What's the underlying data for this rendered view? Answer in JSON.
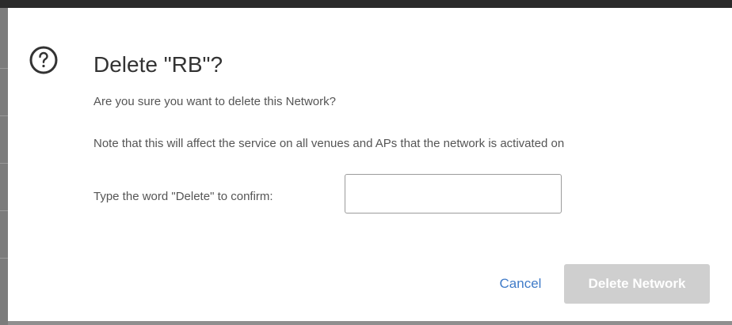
{
  "dialog": {
    "icon": "question-circle-icon",
    "title": "Delete \"RB\"?",
    "question": "Are you sure you want to delete this Network?",
    "note": "Note that this will affect the service on all venues and APs that the network is activated on",
    "confirm_label": "Type the word \"Delete\" to confirm:",
    "confirm_input_value": "",
    "cancel_label": "Cancel",
    "delete_label": "Delete Network"
  },
  "colors": {
    "link": "#3f7bc8",
    "disabled_button": "#cfcfcf",
    "text": "#555555",
    "title": "#333333"
  }
}
